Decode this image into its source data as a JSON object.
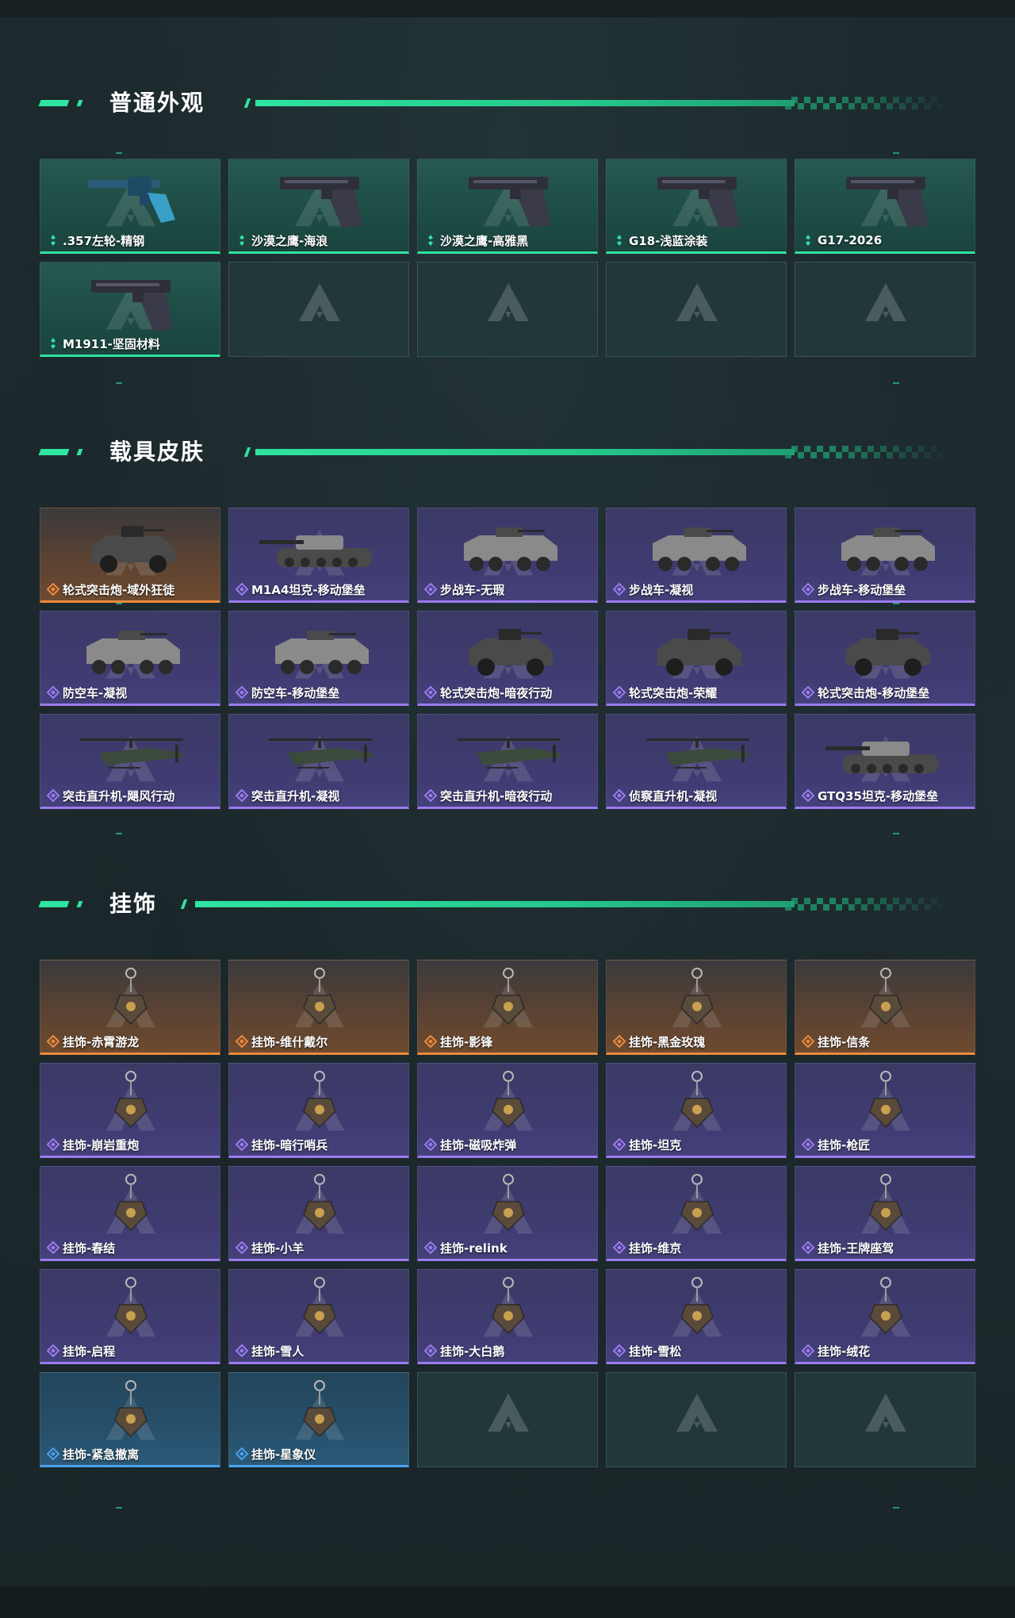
{
  "sections": [
    {
      "title": "普通外观",
      "items": [
        {
          "label": ".357左轮-精钢",
          "rarity": "green",
          "icon": "revolver-icon"
        },
        {
          "label": "沙漠之鹰-海浪",
          "rarity": "green",
          "icon": "pistol-icon"
        },
        {
          "label": "沙漠之鹰-高雅黑",
          "rarity": "green",
          "icon": "pistol-icon"
        },
        {
          "label": "G18-浅蓝涂装",
          "rarity": "green",
          "icon": "pistol-icon"
        },
        {
          "label": "G17-2026",
          "rarity": "green",
          "icon": "pistol-icon"
        },
        {
          "label": "M1911-坚固材料",
          "rarity": "green",
          "icon": "pistol-icon"
        },
        {
          "label": "",
          "rarity": "empty"
        },
        {
          "label": "",
          "rarity": "empty"
        },
        {
          "label": "",
          "rarity": "empty"
        },
        {
          "label": "",
          "rarity": "empty"
        }
      ]
    },
    {
      "title": "载具皮肤",
      "items": [
        {
          "label": "轮式突击炮-域外狂徒",
          "rarity": "orange",
          "icon": "armored-car-icon"
        },
        {
          "label": "M1A4坦克-移动堡垒",
          "rarity": "purple",
          "icon": "tank-icon"
        },
        {
          "label": "步战车-无瑕",
          "rarity": "purple",
          "icon": "ifv-icon"
        },
        {
          "label": "步战车-凝视",
          "rarity": "purple",
          "icon": "ifv-icon"
        },
        {
          "label": "步战车-移动堡垒",
          "rarity": "purple",
          "icon": "ifv-icon"
        },
        {
          "label": "防空车-凝视",
          "rarity": "purple",
          "icon": "ifv-icon"
        },
        {
          "label": "防空车-移动堡垒",
          "rarity": "purple",
          "icon": "ifv-icon"
        },
        {
          "label": "轮式突击炮-暗夜行动",
          "rarity": "purple",
          "icon": "armored-car-icon"
        },
        {
          "label": "轮式突击炮-荣耀",
          "rarity": "purple",
          "icon": "armored-car-icon"
        },
        {
          "label": "轮式突击炮-移动堡垒",
          "rarity": "purple",
          "icon": "armored-car-icon"
        },
        {
          "label": "突击直升机-飓风行动",
          "rarity": "purple",
          "icon": "helicopter-icon"
        },
        {
          "label": "突击直升机-凝视",
          "rarity": "purple",
          "icon": "helicopter-icon"
        },
        {
          "label": "突击直升机-暗夜行动",
          "rarity": "purple",
          "icon": "helicopter-icon"
        },
        {
          "label": "侦察直升机-凝视",
          "rarity": "purple",
          "icon": "helicopter-icon"
        },
        {
          "label": "GTQ35坦克-移动堡垒",
          "rarity": "purple",
          "icon": "tank-icon"
        }
      ]
    },
    {
      "title": "挂饰",
      "items": [
        {
          "label": "挂饰-赤霄游龙",
          "rarity": "orange",
          "icon": "charm-icon"
        },
        {
          "label": "挂饰-维什戴尔",
          "rarity": "orange",
          "icon": "charm-icon"
        },
        {
          "label": "挂饰-影锋",
          "rarity": "orange",
          "icon": "charm-icon"
        },
        {
          "label": "挂饰-黑金玫瑰",
          "rarity": "orange",
          "icon": "charm-icon"
        },
        {
          "label": "挂饰-信条",
          "rarity": "orange",
          "icon": "charm-icon"
        },
        {
          "label": "挂饰-崩岩重炮",
          "rarity": "purple",
          "icon": "charm-icon"
        },
        {
          "label": "挂饰-暗行哨兵",
          "rarity": "purple",
          "icon": "charm-icon"
        },
        {
          "label": "挂饰-磁吸炸弹",
          "rarity": "purple",
          "icon": "charm-icon"
        },
        {
          "label": "挂饰-坦克",
          "rarity": "purple",
          "icon": "charm-icon"
        },
        {
          "label": "挂饰-枪匠",
          "rarity": "purple",
          "icon": "charm-icon"
        },
        {
          "label": "挂饰-春结",
          "rarity": "purple",
          "icon": "charm-icon"
        },
        {
          "label": "挂饰-小羊",
          "rarity": "purple",
          "icon": "charm-icon"
        },
        {
          "label": "挂饰-relink",
          "rarity": "purple",
          "icon": "charm-icon"
        },
        {
          "label": "挂饰-维京",
          "rarity": "purple",
          "icon": "charm-icon"
        },
        {
          "label": "挂饰-王牌座驾",
          "rarity": "purple",
          "icon": "charm-icon"
        },
        {
          "label": "挂饰-启程",
          "rarity": "purple",
          "icon": "charm-icon"
        },
        {
          "label": "挂饰-雪人",
          "rarity": "purple",
          "icon": "charm-icon"
        },
        {
          "label": "挂饰-大白鹅",
          "rarity": "purple",
          "icon": "charm-icon"
        },
        {
          "label": "挂饰-雪松",
          "rarity": "purple",
          "icon": "charm-icon"
        },
        {
          "label": "挂饰-绒花",
          "rarity": "purple",
          "icon": "charm-icon"
        },
        {
          "label": "挂饰-紧急撤离",
          "rarity": "blue",
          "icon": "charm-icon"
        },
        {
          "label": "挂饰-星象仪",
          "rarity": "blue",
          "icon": "charm-icon"
        },
        {
          "label": "",
          "rarity": "empty"
        },
        {
          "label": "",
          "rarity": "empty"
        },
        {
          "label": "",
          "rarity": "empty"
        }
      ]
    }
  ],
  "colors": {
    "accent": "#2fe3a0",
    "green": "#2fe3a0",
    "orange": "#f08a3a",
    "purple": "#9b7bf0",
    "blue": "#4aa0f0"
  }
}
